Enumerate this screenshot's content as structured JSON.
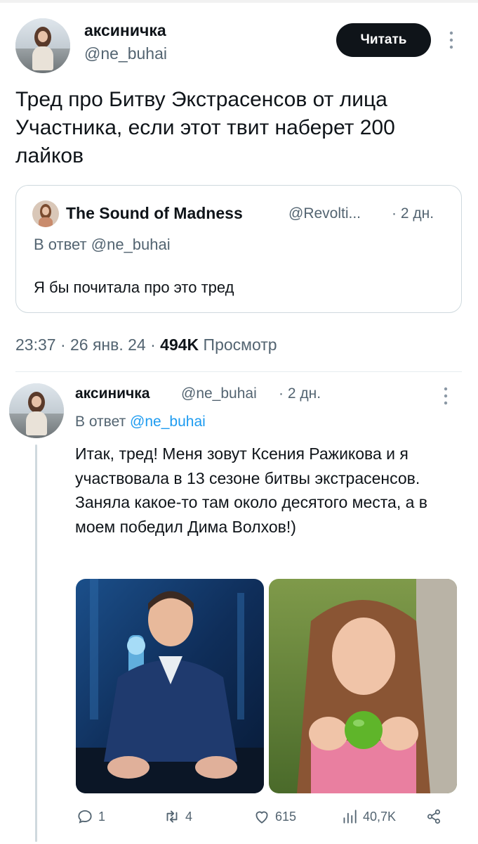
{
  "main_tweet": {
    "author_name": "аксиничка",
    "author_handle": "@ne_buhai",
    "follow_label": "Читать",
    "text": "Тред про Битву Экстрасенсов от лица Участника, если этот твит наберет 200 лайков",
    "quote": {
      "author_name": "The Sound of Madness",
      "author_handle": "@Revolti...",
      "time": "· 2 дн.",
      "reply_to_prefix": "В ответ",
      "reply_to_handle": "@ne_buhai",
      "text": "Я бы почитала про это тред"
    },
    "time": "23:37 · 26 янв. 24 ·",
    "views_count": "494K",
    "views_label": "Просмотр"
  },
  "reply_tweet": {
    "author_name": "аксиничка",
    "author_handle": "@ne_buhai",
    "time": "· 2 дн.",
    "reply_to_prefix": "В ответ",
    "reply_to_handle": "@ne_buhai",
    "text": "Итак, тред! Меня зовут Ксения Ражикова и я участвовала в 13 сезоне битвы экстрасенсов. Заняла какое-то там около десятого места, а в моем победил Дима Волхов!)",
    "actions": {
      "replies": "1",
      "retweets": "4",
      "likes": "615",
      "views": "40,7K"
    }
  },
  "icons": [
    "more-icon",
    "reply-icon",
    "retweet-icon",
    "like-icon",
    "views-icon",
    "share-icon"
  ]
}
